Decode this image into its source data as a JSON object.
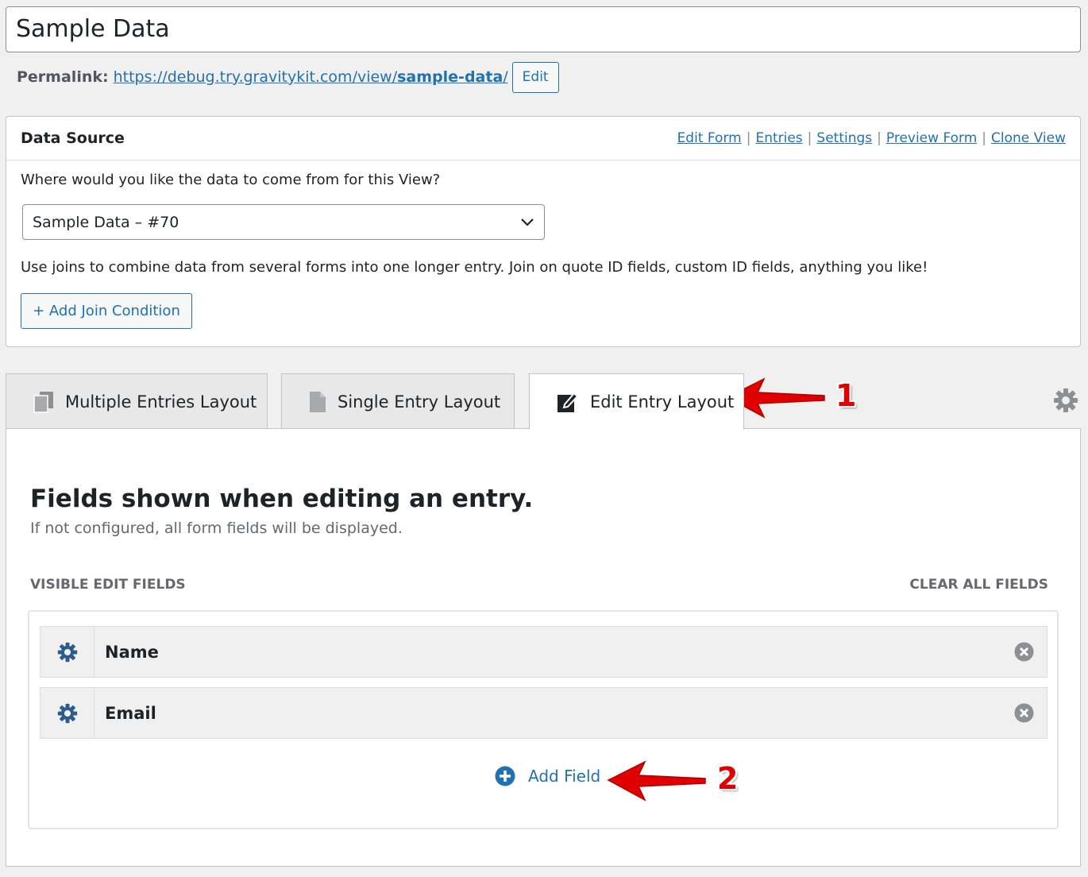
{
  "title_field": {
    "value": "Sample Data"
  },
  "permalink": {
    "label": "Permalink:",
    "url_prefix": "https://debug.try.gravitykit.com/view/",
    "url_slug": "sample-data",
    "url_suffix": "/",
    "edit_label": "Edit"
  },
  "data_source": {
    "heading": "Data Source",
    "links": [
      "Edit Form",
      "Entries",
      "Settings",
      "Preview Form",
      "Clone View"
    ],
    "question": "Where would you like the data to come from for this View?",
    "selected_form": "Sample Data – #70",
    "joins_help": "Use joins to combine data from several forms into one longer entry. Join on quote ID fields, custom ID fields, anything you like!",
    "add_join_label": "+ Add Join Condition"
  },
  "tabs": [
    {
      "label": "Multiple Entries Layout",
      "icon": "copy-icon"
    },
    {
      "label": "Single Entry Layout",
      "icon": "document-icon"
    },
    {
      "label": "Edit Entry Layout",
      "icon": "edit-icon",
      "active": true
    }
  ],
  "edit_layout": {
    "heading": "Fields shown when editing an entry.",
    "subheading": "If not configured, all form fields will be displayed.",
    "visible_label": "Visible Edit Fields",
    "clear_label": "Clear All Fields",
    "fields": [
      {
        "label": "Name"
      },
      {
        "label": "Email"
      }
    ],
    "add_field_label": "Add Field"
  },
  "annotations": {
    "callout_1": "1",
    "callout_2": "2",
    "arrow_color": "#e00000"
  },
  "colors": {
    "accent": "#2271b1",
    "background": "#f0f0f1"
  }
}
